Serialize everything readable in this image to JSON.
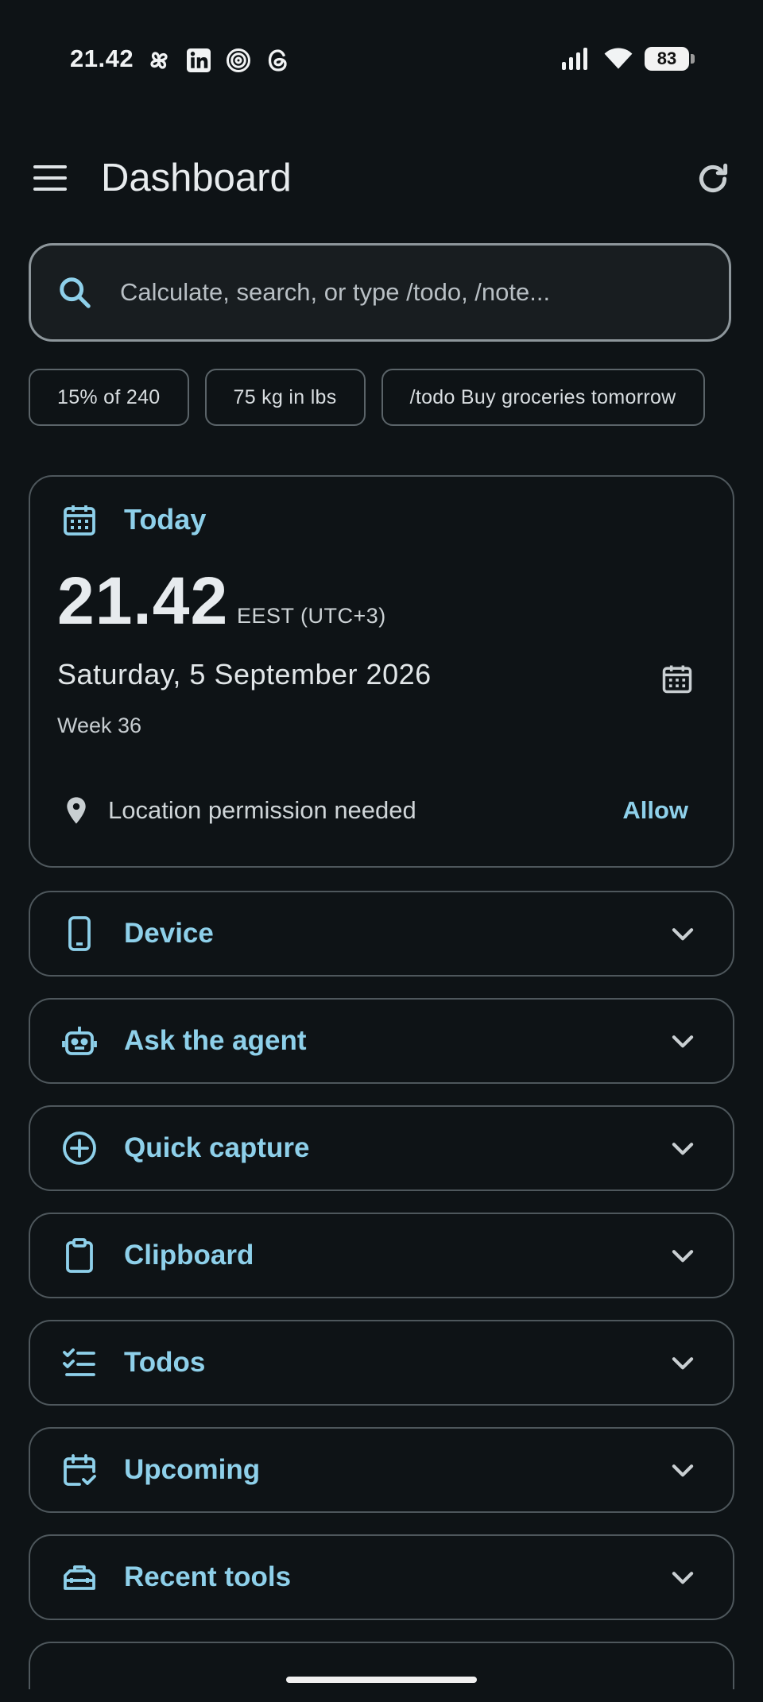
{
  "status_bar": {
    "time": "21.42",
    "battery": "83"
  },
  "app_bar": {
    "title": "Dashboard"
  },
  "search": {
    "placeholder": "Calculate, search, or type /todo, /note..."
  },
  "chips": [
    "15% of 240",
    "75 kg in lbs",
    "/todo Buy groceries tomorrow"
  ],
  "today": {
    "title": "Today",
    "time": "21.42",
    "timezone": "EEST (UTC+3)",
    "date": "Saturday, 5 September 2026",
    "week": "Week 36",
    "location_text": "Location permission needed",
    "allow_label": "Allow"
  },
  "sections": [
    {
      "title": "Device",
      "icon": "phone-icon"
    },
    {
      "title": "Ask the agent",
      "icon": "robot-icon"
    },
    {
      "title": "Quick capture",
      "icon": "plus-circle-icon"
    },
    {
      "title": "Clipboard",
      "icon": "clipboard-icon"
    },
    {
      "title": "Todos",
      "icon": "checklist-icon"
    },
    {
      "title": "Upcoming",
      "icon": "calendar-check-icon"
    },
    {
      "title": "Recent tools",
      "icon": "toolbox-icon"
    }
  ],
  "colors": {
    "background": "#0e1316",
    "accent": "#8ed0ea",
    "border": "#4e575c"
  }
}
